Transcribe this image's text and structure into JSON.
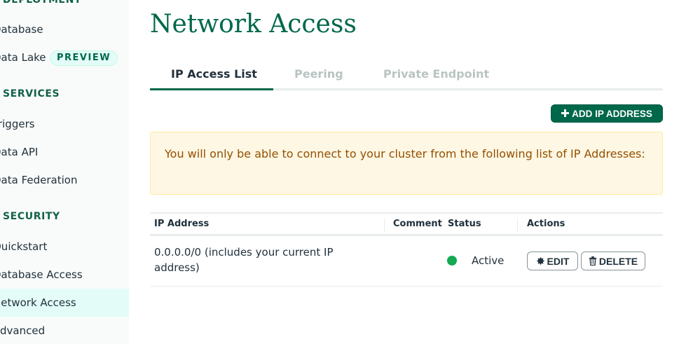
{
  "sidebar": {
    "sections": [
      {
        "id": "deployment",
        "label": "DEPLOYMENT"
      },
      {
        "id": "services",
        "label": "SERVICES"
      },
      {
        "id": "security",
        "label": "SECURITY"
      }
    ],
    "items": [
      {
        "id": "database",
        "label": "Database"
      },
      {
        "id": "data-lake",
        "label": "Data Lake",
        "badge": "PREVIEW"
      },
      {
        "id": "triggers",
        "label": "Triggers"
      },
      {
        "id": "data-api",
        "label": "Data API"
      },
      {
        "id": "data-federation",
        "label": "Data Federation"
      },
      {
        "id": "quickstart",
        "label": "Quickstart"
      },
      {
        "id": "database-access",
        "label": "Database Access"
      },
      {
        "id": "network-access",
        "label": "Network Access",
        "active": true
      },
      {
        "id": "advanced",
        "label": "Advanced"
      }
    ]
  },
  "page": {
    "title": "Network Access"
  },
  "tabs": [
    {
      "label": "IP Access List",
      "active": true
    },
    {
      "label": "Peering",
      "active": false
    },
    {
      "label": "Private Endpoint",
      "active": false
    }
  ],
  "add_button": {
    "label": "ADD IP ADDRESS",
    "icon": "plus-icon"
  },
  "banner": {
    "text": "You will only be able to connect to your cluster from the following list of IP Addresses:"
  },
  "table": {
    "headers": [
      "IP Address",
      "Comment",
      "Status",
      "Actions"
    ],
    "rows": [
      {
        "ip": "0.0.0.0/0",
        "ip_note": "(includes your current IP address)",
        "comment": "",
        "status": "Active",
        "edit_label": "EDIT",
        "delete_label": "DELETE"
      }
    ]
  },
  "colors": {
    "brand_green": "#00684a",
    "status_active": "#13aa52",
    "warning_bg": "#fef7e3",
    "warning_text": "#944f01"
  }
}
